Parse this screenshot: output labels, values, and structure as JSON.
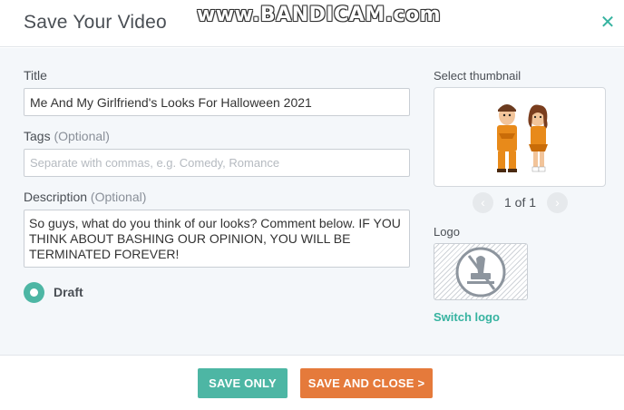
{
  "header": {
    "title": "Save Your Video",
    "close_icon": "close-icon",
    "watermark": "www.BANDICAM.com"
  },
  "form": {
    "title_label": "Title",
    "title_value": "Me And My Girlfriend's Looks For Halloween 2021",
    "tags_label": "Tags",
    "tags_optional": "(Optional)",
    "tags_placeholder": "Separate with commas, e.g. Comedy, Romance",
    "description_label": "Description",
    "description_optional": "(Optional)",
    "description_value": "So guys, what do you think of our looks? Comment below. IF YOU THINK ABOUT BASHING OUR OPINION, YOU WILL BE TERMINATED FOREVER!",
    "draft_label": "Draft",
    "draft_selected": true
  },
  "thumbnail": {
    "label": "Select thumbnail",
    "pager_text": "1 of 1",
    "prev_icon": "chevron-left-icon",
    "next_icon": "chevron-right-icon"
  },
  "logo": {
    "label": "Logo",
    "placeholder_icon": "stamp-icon",
    "switch_label": "Switch logo"
  },
  "footer": {
    "save_only_label": "SAVE ONLY",
    "save_close_label": "SAVE AND CLOSE >"
  },
  "colors": {
    "accent_teal": "#4db6a4",
    "accent_orange": "#e57a3b",
    "link_teal": "#36b3a0",
    "panel_bg": "#f4f7fa"
  }
}
